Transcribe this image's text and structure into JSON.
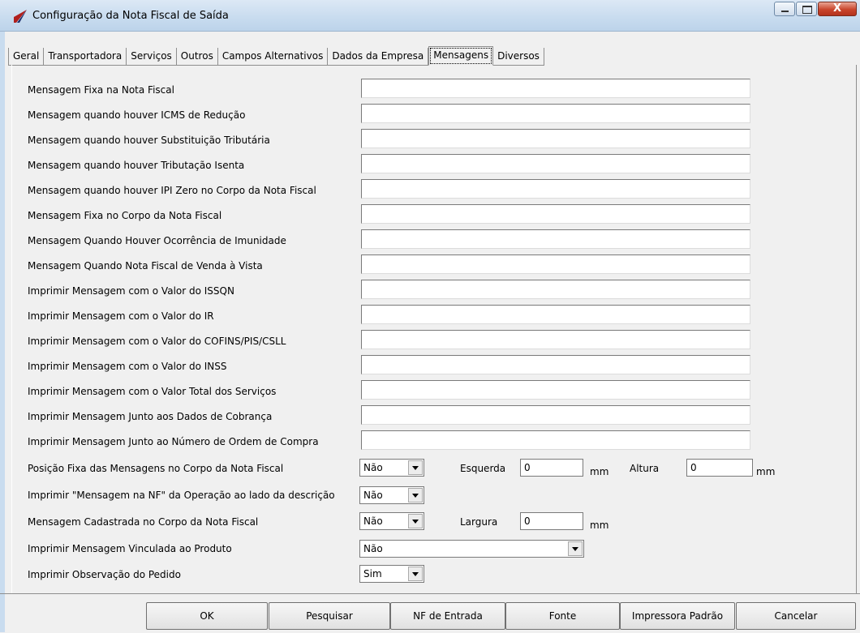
{
  "window": {
    "title": "Configuração da Nota Fiscal de Saída",
    "close_glyph": "X"
  },
  "tabs": [
    {
      "label": "Geral"
    },
    {
      "label": "Transportadora"
    },
    {
      "label": "Serviços"
    },
    {
      "label": "Outros"
    },
    {
      "label": "Campos Alternativos"
    },
    {
      "label": "Dados da Empresa"
    },
    {
      "label": "Mensagens"
    },
    {
      "label": "Diversos"
    }
  ],
  "active_tab": "Mensagens",
  "messages": [
    {
      "label": "Mensagem Fixa na Nota Fiscal",
      "value": ""
    },
    {
      "label": "Mensagem quando houver ICMS de Redução",
      "value": ""
    },
    {
      "label": "Mensagem quando houver Substituição Tributária",
      "value": ""
    },
    {
      "label": "Mensagem quando houver Tributação Isenta",
      "value": ""
    },
    {
      "label": "Mensagem quando houver IPI Zero no Corpo da Nota Fiscal",
      "value": ""
    },
    {
      "label": "Mensagem Fixa no Corpo da Nota Fiscal",
      "value": ""
    },
    {
      "label": "Mensagem Quando Houver Ocorrência de Imunidade",
      "value": ""
    },
    {
      "label": "Mensagem Quando Nota Fiscal de Venda à Vista",
      "value": ""
    },
    {
      "label": "Imprimir Mensagem com o Valor do ISSQN",
      "value": ""
    },
    {
      "label": "Imprimir Mensagem com o Valor do IR",
      "value": ""
    },
    {
      "label": "Imprimir Mensagem com o Valor do COFINS/PIS/CSLL",
      "value": ""
    },
    {
      "label": "Imprimir Mensagem com o Valor do INSS",
      "value": ""
    },
    {
      "label": "Imprimir Mensagem com o Valor Total dos Serviços",
      "value": ""
    },
    {
      "label": "Imprimir Mensagem Junto aos Dados de Cobrança",
      "value": ""
    },
    {
      "label": "Imprimir Mensagem Junto ao Número de Ordem de Compra",
      "value": ""
    }
  ],
  "options": {
    "posicao_fixa": {
      "label": "Posição Fixa das Mensagens no Corpo da Nota Fiscal",
      "value": "Não"
    },
    "esquerda": {
      "label": "Esquerda",
      "value": "0",
      "unit": "mm"
    },
    "altura": {
      "label": "Altura",
      "value": "0",
      "unit": "mm"
    },
    "mensagem_nf_operacao": {
      "label": "Imprimir \"Mensagem na NF\" da Operação ao lado da descrição",
      "value": "Não"
    },
    "mensagem_cadastrada": {
      "label": "Mensagem Cadastrada no Corpo da Nota Fiscal",
      "value": "Não"
    },
    "largura": {
      "label": "Largura",
      "value": "0",
      "unit": "mm"
    },
    "mensagem_vinculada": {
      "label": "Imprimir Mensagem Vinculada ao Produto",
      "value": "Não"
    },
    "observacao_pedido": {
      "label": "Imprimir Observação do Pedido",
      "value": "Sim"
    }
  },
  "buttons": [
    {
      "label": "OK"
    },
    {
      "label": "Pesquisar"
    },
    {
      "label": "NF de Entrada"
    },
    {
      "label": "Fonte"
    },
    {
      "label": "Impressora Padrão"
    },
    {
      "label": "Cancelar"
    }
  ]
}
